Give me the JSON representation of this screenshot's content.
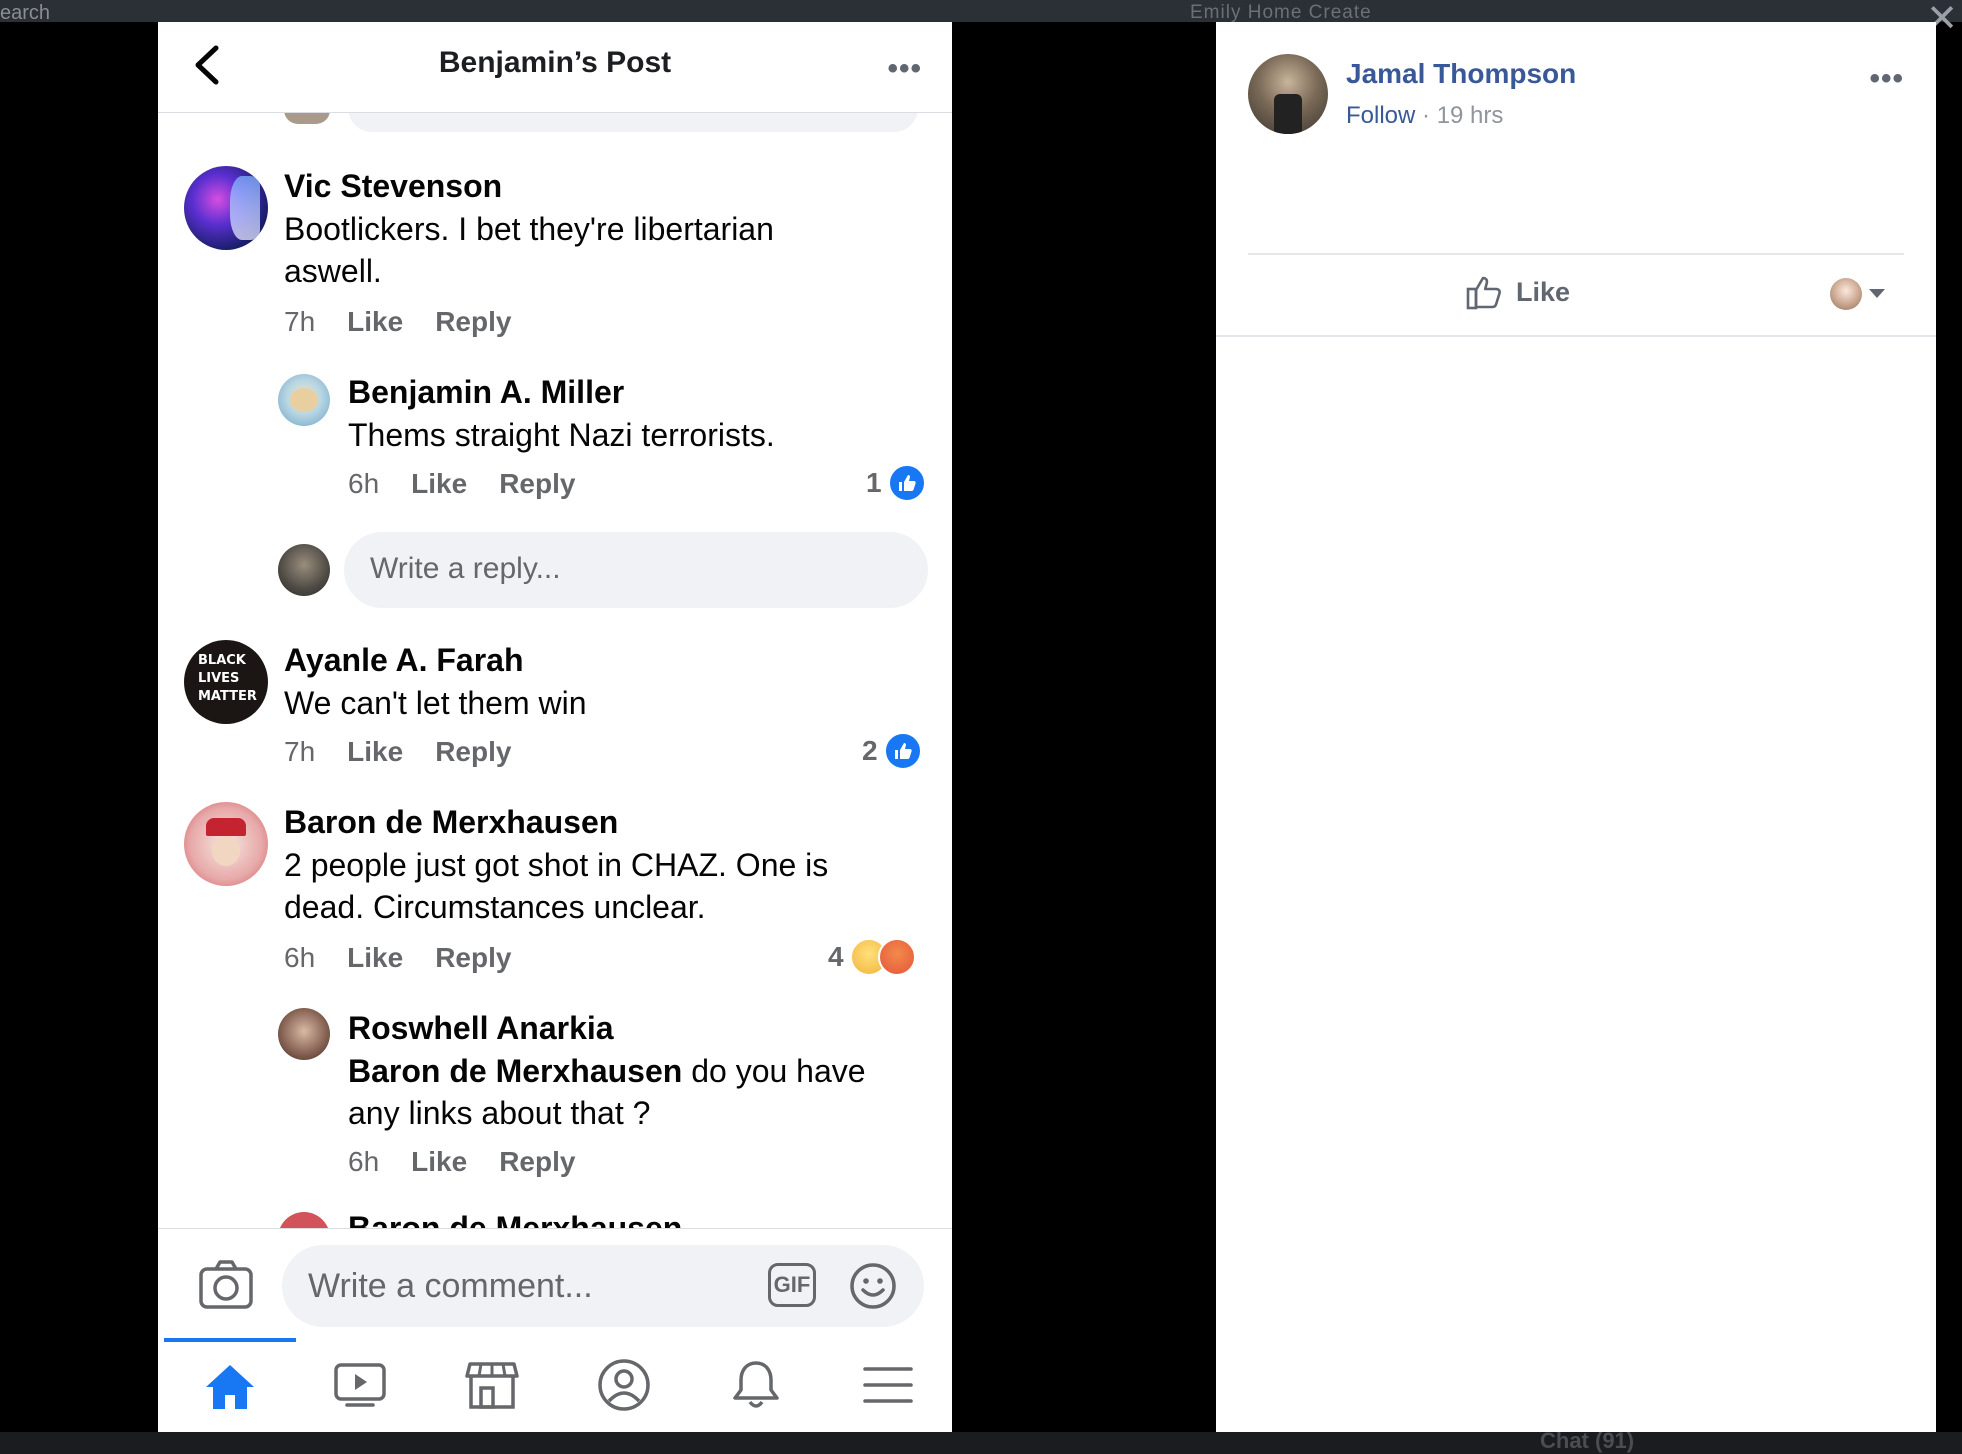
{
  "background": {
    "search_fragment": "earch",
    "nav_fragment": "Emily   Home   Create",
    "chat_fragment": "Chat (91)"
  },
  "phone": {
    "title": "Benjamin’s Post",
    "comments": [
      {
        "name": "Vic Stevenson",
        "text": "Bootlickers. I bet they're libertarian aswell.",
        "time": "7h",
        "like": "Like",
        "reply": "Reply"
      },
      {
        "name": "Benjamin A. Miller",
        "text": "Thems straight Nazi terrorists.",
        "time": "6h",
        "like": "Like",
        "reply": "Reply",
        "reactions": "1"
      },
      {
        "name": "Ayanle A. Farah",
        "text": "We can't let them win",
        "time": "7h",
        "like": "Like",
        "reply": "Reply",
        "reactions": "2",
        "avatar_text": "BLACK LIVES MATTER"
      },
      {
        "name": "Baron de Merxhausen",
        "text": "2 people just got shot in CHAZ. One is dead. Circumstances unclear.",
        "time": "6h",
        "like": "Like",
        "reply": "Reply",
        "reactions": "4"
      },
      {
        "name": "Roswhell Anarkia",
        "mention": "Baron de Merxhausen",
        "text": " do you have any links about that ?",
        "time": "6h",
        "like": "Like",
        "reply": "Reply"
      }
    ],
    "reply_placeholder": "Write a reply...",
    "cut_name": "Baron de Merxhausen",
    "composer_placeholder": "Write a comment...",
    "gif_label": "GIF"
  },
  "panel": {
    "author": "Jamal Thompson",
    "follow": "Follow",
    "separator": " · ",
    "time": "19 hrs",
    "like_label": "Like"
  },
  "colors": {
    "facebook_blue": "#1877f2",
    "link_blue": "#385898",
    "gray_text": "#65676b"
  }
}
